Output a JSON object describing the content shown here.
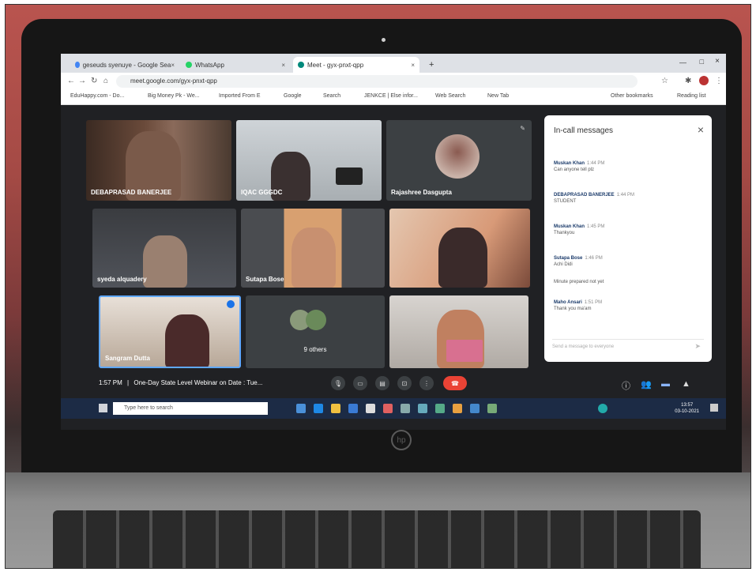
{
  "browser": {
    "tabs": [
      {
        "label": "geseuds syenuye - Google Sea",
        "close": "×"
      },
      {
        "label": "WhatsApp",
        "close": "×"
      },
      {
        "label": "Meet - gyx-pnxt-qpp",
        "close": "×"
      }
    ],
    "new_tab": "+",
    "url": "meet.google.com/gyx-pnxt-qpp",
    "bookmarks": [
      "EduHappy.com - Do...",
      "Big Money Pk - We...",
      "Imported From E",
      "Google",
      "Search",
      "JENKCE | Else infor...",
      "Web Search",
      "New Tab",
      "Other bookmarks",
      "Reading list"
    ]
  },
  "participants": [
    {
      "name": "DEBAPRASAD BANERJEE"
    },
    {
      "name": "IQAC GGGDC"
    },
    {
      "name": "Rajashree Dasgupta"
    },
    {
      "name": "syeda alquadery"
    },
    {
      "name": "Sutapa Bose"
    },
    {
      "name": ""
    },
    {
      "name": "Sangram Dutta"
    },
    {
      "name": "9 others"
    },
    {
      "name": ""
    }
  ],
  "chat": {
    "title": "In-call messages",
    "close": "×",
    "messages": [
      {
        "author": "Muskan Khan",
        "time": "1:44 PM",
        "text": "Can anyone tell plz"
      },
      {
        "author": "DEBAPRASAD BANERJEE",
        "time": "1:44 PM",
        "text": "STUDENT"
      },
      {
        "author": "Muskan Khan",
        "time": "1:45 PM",
        "text": "Thankyou"
      },
      {
        "author": "Sutapa Bose",
        "time": "1:46 PM",
        "text": "Achi Didi"
      },
      {
        "author": "",
        "time": "",
        "text": "Minute prepared not yet"
      },
      {
        "author": "Maho Ansari",
        "time": "1:51 PM",
        "text": "Thank you ma'am"
      }
    ],
    "input_placeholder": "Send a message to everyone"
  },
  "meeting": {
    "time": "1:57 PM",
    "separator": "|",
    "title": "One-Day State Level Webinar on Date : Tue..."
  },
  "taskbar": {
    "search_placeholder": "Type here to search",
    "clock_time": "13:57",
    "clock_date": "03-10-2021"
  },
  "brand": "hp"
}
